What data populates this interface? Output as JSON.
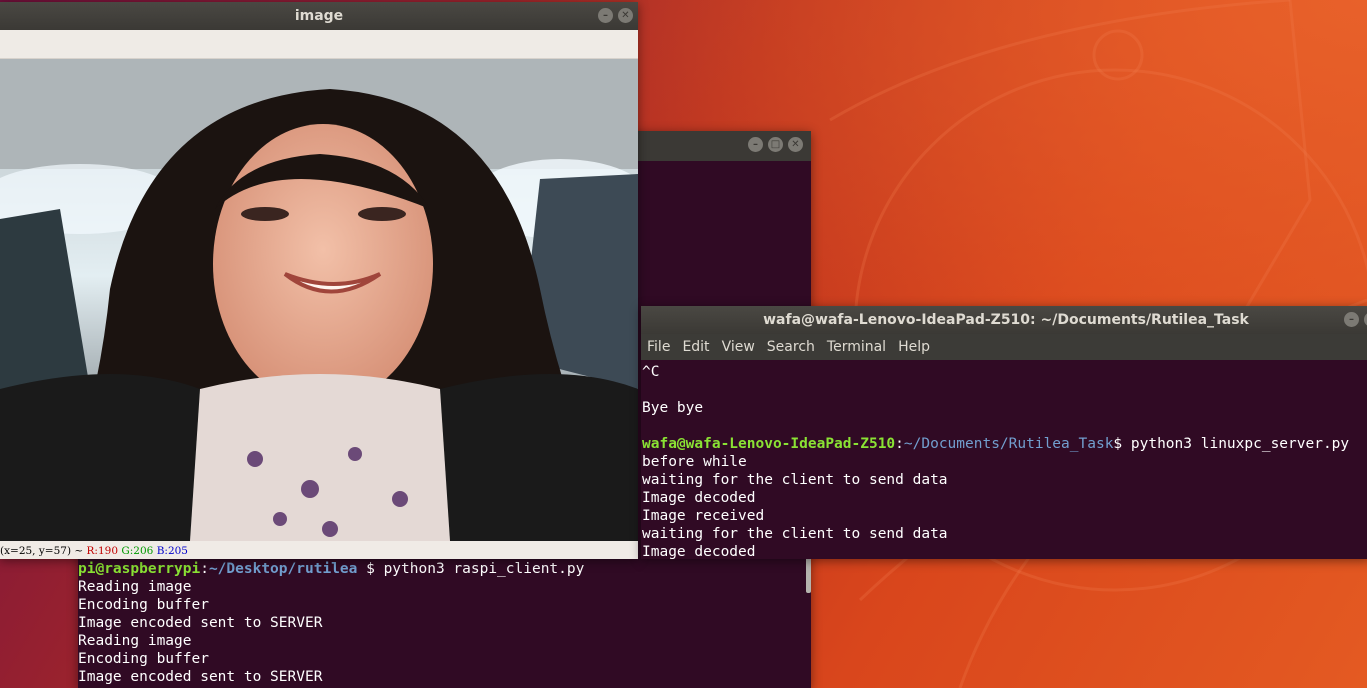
{
  "desktop": {
    "accent": "#e95420"
  },
  "image_window": {
    "title": "image",
    "status": {
      "coords": "(x=25, y=57) ~",
      "r": "R:190",
      "g": "G:206",
      "b": "B:205"
    },
    "buttons": [
      "minimize-icon",
      "close-icon"
    ]
  },
  "pi_terminal": {
    "prompt_user": "pi@raspberrypi",
    "prompt_sep": ":",
    "prompt_path": "~/Desktop/rutilea",
    "prompt_end": " $ ",
    "command": "python3 raspi_client.py",
    "lines": [
      "Reading image",
      "Encoding buffer",
      "Image encoded sent to SERVER",
      "Reading image",
      "Encoding buffer",
      "Image encoded sent to SERVER"
    ]
  },
  "server_terminal": {
    "title": "wafa@wafa-Lenovo-IdeaPad-Z510: ~/Documents/Rutilea_Task",
    "menu": [
      "File",
      "Edit",
      "View",
      "Search",
      "Terminal",
      "Help"
    ],
    "lines_before": [
      "^C",
      "",
      "Bye bye",
      ""
    ],
    "prompt_user": "wafa@wafa-Lenovo-IdeaPad-Z510",
    "prompt_sep": ":",
    "prompt_path": "~/Documents/Rutilea_Task",
    "prompt_end": "$ ",
    "command": "python3 linuxpc_server.py",
    "lines_after": [
      "before while",
      "waiting for the client to send data",
      "Image decoded",
      "Image received",
      "waiting for the client to send data",
      "Image decoded"
    ]
  }
}
